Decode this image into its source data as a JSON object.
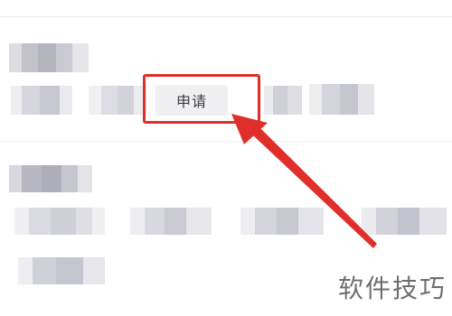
{
  "filters": {
    "apply_chip_label": "申请"
  },
  "watermark": {
    "text": "软件技巧"
  },
  "colors": {
    "highlight": "#e02f2a",
    "chip_background": "#f0f0f2",
    "divider": "#ededf0",
    "blurred_text": "#c8c8d0"
  }
}
